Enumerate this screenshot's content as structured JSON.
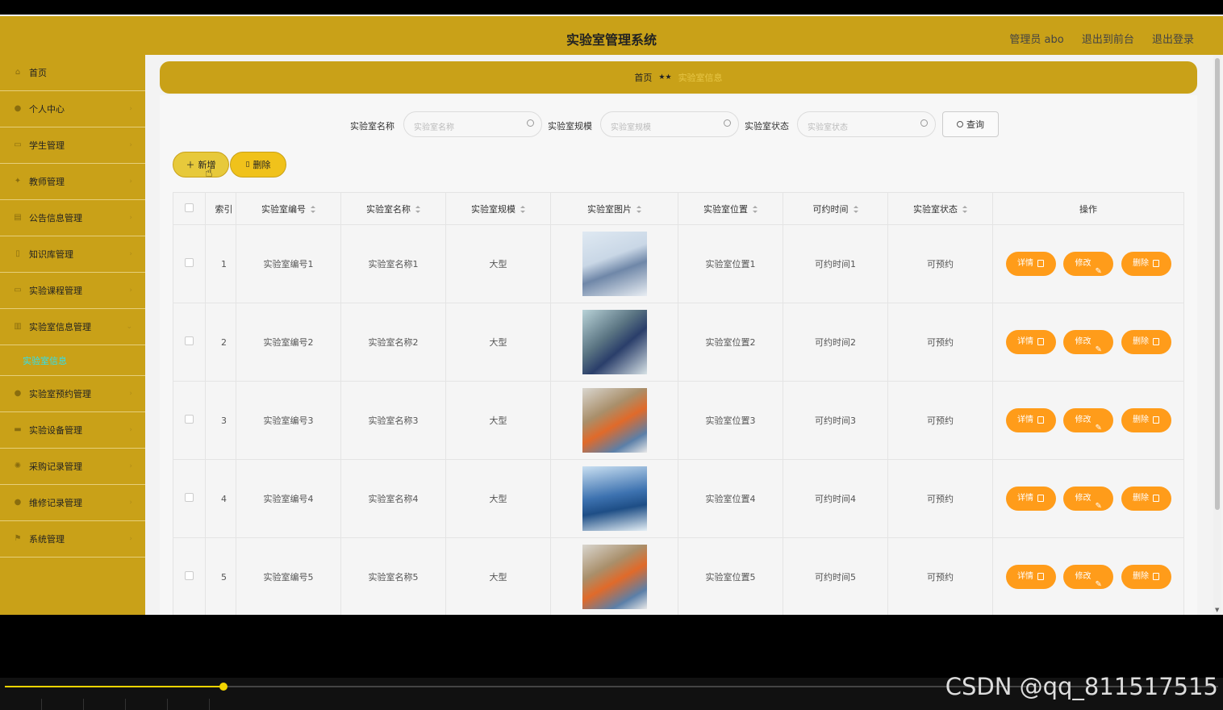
{
  "header": {
    "title": "实验室管理系统",
    "admin": "管理员 abo",
    "back_front": "退出到前台",
    "logout": "退出登录"
  },
  "sidebar": {
    "items": [
      {
        "label": "首页",
        "icon": "home-icon"
      },
      {
        "label": "个人中心",
        "icon": "user-icon"
      },
      {
        "label": "学生管理",
        "icon": "folder-icon"
      },
      {
        "label": "教师管理",
        "icon": "star-icon"
      },
      {
        "label": "公告信息管理",
        "icon": "notice-icon"
      },
      {
        "label": "知识库管理",
        "icon": "book-icon"
      },
      {
        "label": "实验课程管理",
        "icon": "course-icon"
      },
      {
        "label": "实验室信息管理",
        "icon": "chart-icon"
      }
    ],
    "active_sub": "实验室信息",
    "items_after": [
      {
        "label": "实验室预约管理",
        "icon": "user-icon"
      },
      {
        "label": "实验设备管理",
        "icon": "device-icon"
      },
      {
        "label": "采购记录管理",
        "icon": "gear-icon"
      },
      {
        "label": "维修记录管理",
        "icon": "user-icon"
      },
      {
        "label": "系统管理",
        "icon": "flag-icon"
      }
    ]
  },
  "breadcrumb": {
    "home": "首页",
    "sep": "★★",
    "current": "实验室信息"
  },
  "search": {
    "name_label": "实验室名称",
    "name_placeholder": "实验室名称",
    "scale_label": "实验室规模",
    "scale_placeholder": "实验室规模",
    "status_label": "实验室状态",
    "status_placeholder": "实验室状态",
    "query_button": "查询"
  },
  "toolbar": {
    "add": "新增",
    "delete": "删除"
  },
  "table": {
    "headers": [
      "索引",
      "实验室编号",
      "实验室名称",
      "实验室规模",
      "实验室图片",
      "实验室位置",
      "可约时间",
      "实验室状态",
      "操作"
    ],
    "rows": [
      {
        "idx": "1",
        "code": "实验室编号1",
        "name": "实验室名称1",
        "scale": "大型",
        "location": "实验室位置1",
        "time": "可约时间1",
        "status": "可预约"
      },
      {
        "idx": "2",
        "code": "实验室编号2",
        "name": "实验室名称2",
        "scale": "大型",
        "location": "实验室位置2",
        "time": "可约时间2",
        "status": "可预约"
      },
      {
        "idx": "3",
        "code": "实验室编号3",
        "name": "实验室名称3",
        "scale": "大型",
        "location": "实验室位置3",
        "time": "可约时间3",
        "status": "可预约"
      },
      {
        "idx": "4",
        "code": "实验室编号4",
        "name": "实验室名称4",
        "scale": "大型",
        "location": "实验室位置4",
        "time": "可约时间4",
        "status": "可预约"
      },
      {
        "idx": "5",
        "code": "实验室编号5",
        "name": "实验室名称5",
        "scale": "大型",
        "location": "实验室位置5",
        "time": "可约时间5",
        "status": "可预约"
      }
    ],
    "actions": {
      "detail": "详情",
      "edit": "修改",
      "remove": "删除"
    }
  },
  "watermark": "CSDN @qq_811517515",
  "player": {
    "progress": 0.18
  },
  "colors": {
    "brand": "#c9a118",
    "action": "#ff9c1a",
    "active_sub": "#2fe0f0"
  }
}
